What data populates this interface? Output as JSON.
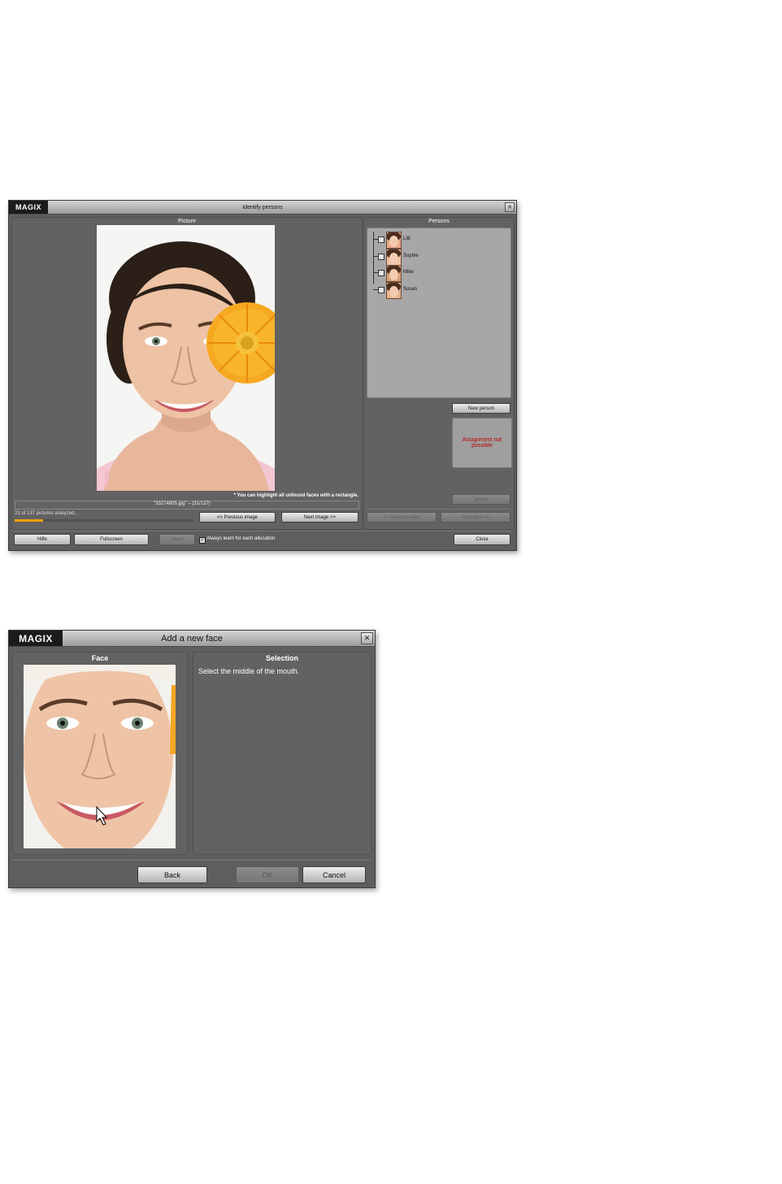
{
  "identify": {
    "logo": "MAGIX",
    "title": "Identify persons",
    "close_glyph": "✕",
    "picture_header": "Picture",
    "persons_header": "Persons",
    "persons": [
      {
        "name": "Lilli"
      },
      {
        "name": "Sophie"
      },
      {
        "name": "Mike"
      },
      {
        "name": "Susan"
      }
    ],
    "new_person": "New person",
    "assignment_status": "Assignment not possible",
    "ignore": "Ignore",
    "hint": "* You can highlight all unfound faces with a rectangle.",
    "filename": "\"33274805.jpg\" – (31/137)",
    "analysis_status": "22 of 137 pictures analyzed...",
    "analysis_progress": 0.16,
    "prev_image": "<< Previous image",
    "next_image": "Next image >>",
    "prev_face": "<< Previous face",
    "next_face": "Next face >>",
    "help": "Hilfe",
    "fullscreen": "Fullscreen",
    "learn": "Learn",
    "always_learn": "Always learn for each allocation",
    "always_learn_checked": true,
    "close": "Close"
  },
  "add_face": {
    "logo": "MAGIX",
    "title": "Add a new face",
    "close_glyph": "✕",
    "face_header": "Face",
    "selection_header": "Selection",
    "instruction": "Select the middle of the mouth.",
    "back": "Back",
    "ok": "OK",
    "cancel": "Cancel"
  },
  "colors": {
    "window_bg": "#5e5e5e",
    "accent_red": "#c00000",
    "progress": "#f0a000"
  }
}
